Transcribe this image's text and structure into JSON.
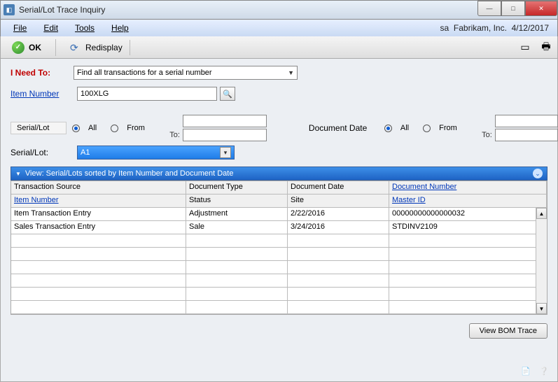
{
  "window": {
    "title": "Serial/Lot Trace Inquiry"
  },
  "menubar": {
    "file": "File",
    "edit": "Edit",
    "tools": "Tools",
    "help": "Help",
    "context_user": "sa",
    "context_company": "Fabrikam, Inc.",
    "context_date": "4/12/2017"
  },
  "toolbar": {
    "ok": "OK",
    "redisplay": "Redisplay"
  },
  "need_to": {
    "label": "I Need To:",
    "value": "Find all transactions for a serial number"
  },
  "item_number": {
    "label": "Item Number",
    "value": "100XLG"
  },
  "serial_filter": {
    "label": "Serial/Lot",
    "opt_all": "All",
    "opt_from": "From",
    "to": "To:"
  },
  "docdate_filter": {
    "label": "Document Date",
    "opt_all": "All",
    "opt_from": "From",
    "to": "To:"
  },
  "serial_select": {
    "label": "Serial/Lot:",
    "value": "A1"
  },
  "viewbar": {
    "text": "View: Serial/Lots sorted by Item Number and  Document Date"
  },
  "grid": {
    "hdr1": {
      "c1": "Transaction Source",
      "c2": "Document Type",
      "c3": "Document Date",
      "c4": "Document Number"
    },
    "hdr2": {
      "c1": "Item Number",
      "c2": "Status",
      "c3": "Site",
      "c4": "Master ID"
    },
    "rows": [
      {
        "c1": "Item Transaction Entry",
        "c2": "Adjustment",
        "c3": "2/22/2016",
        "c4": "00000000000000032"
      },
      {
        "c1": "Sales Transaction Entry",
        "c2": "Sale",
        "c3": "3/24/2016",
        "c4": "STDINV2109"
      }
    ]
  },
  "footer": {
    "bom": "View BOM Trace"
  }
}
